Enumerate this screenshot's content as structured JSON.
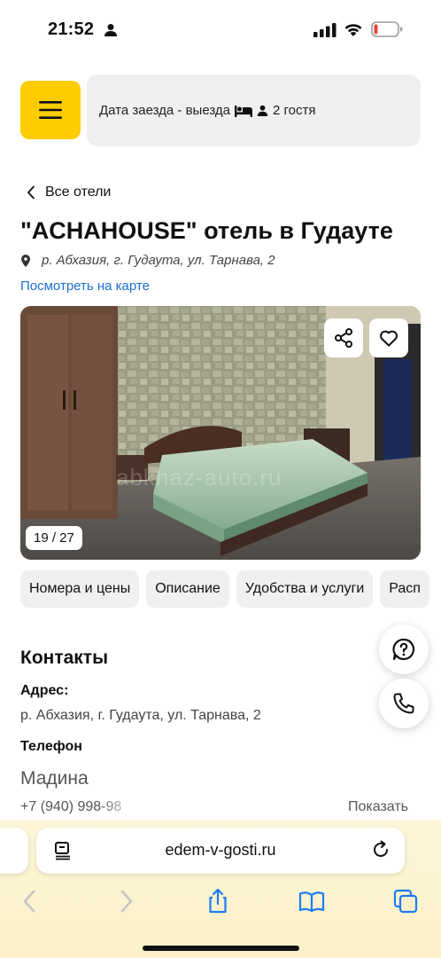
{
  "status_bar": {
    "time": "21:52",
    "icons": [
      "person-icon",
      "signal-icon",
      "wifi-icon",
      "battery-low-icon"
    ],
    "battery_color": "#e5453c"
  },
  "header": {
    "menu_icon": "hamburger-icon",
    "menu_color": "#ffcc00",
    "search_prefix": "Дата заезда - выезда",
    "search_icons": [
      "bed-icon",
      "person-icon"
    ],
    "guests": "2 гостя"
  },
  "breadcrumb": {
    "back_label": "Все отели"
  },
  "hotel": {
    "title": "\"ACHAHOUSE\" отель в Гудауте",
    "address": "р. Абхазия, г. Гудаута, ул. Тарнава, 2",
    "map_link": "Посмотреть на карте",
    "link_color": "#1b6fd1"
  },
  "gallery": {
    "counter": "19 / 27",
    "watermark": "abkhaz-auto.ru",
    "actions": [
      "share-icon",
      "heart-icon"
    ]
  },
  "tabs": [
    {
      "label": "Номера и цены"
    },
    {
      "label": "Описание"
    },
    {
      "label": "Удобства и услуги"
    },
    {
      "label": "Расп"
    }
  ],
  "contacts": {
    "title": "Контакты",
    "address_label": "Адрес:",
    "address_value": "р. Абхазия, г. Гудаута, ул. Тарнава, 2",
    "phone_label": "Телефон",
    "contact_name": "Мадина",
    "phone_masked": "+7 (940) 998-98",
    "show_label": "Показать"
  },
  "floating_buttons": [
    "help-chat-icon",
    "phone-icon"
  ],
  "browser": {
    "url": "edem-v-gosti.ru",
    "icons": [
      "reader-icon",
      "reload-icon"
    ],
    "toolbar": [
      "back-icon",
      "forward-icon",
      "share-icon",
      "bookmarks-icon",
      "tabs-icon"
    ],
    "accent_color": "#1a7cf2"
  }
}
